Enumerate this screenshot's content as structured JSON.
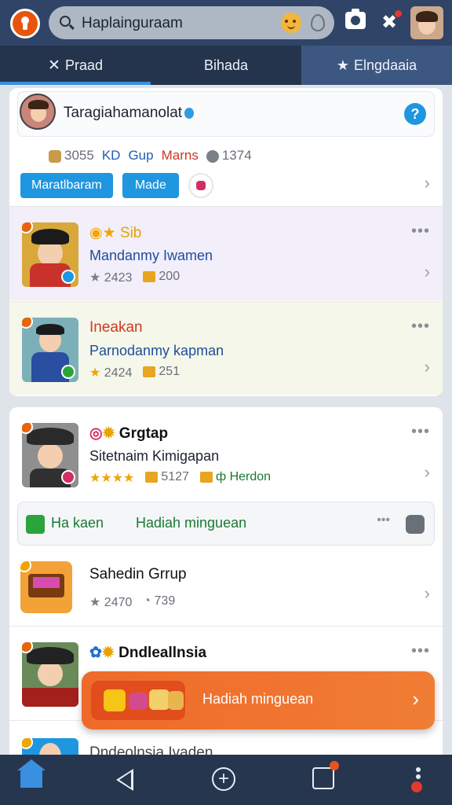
{
  "search": {
    "value": "Haplainguraam"
  },
  "tabs": [
    {
      "label": "Praad"
    },
    {
      "label": "Bihada"
    },
    {
      "label": "Elngdaaia"
    }
  ],
  "profile": {
    "name": "Taragiahamanolat",
    "stats": [
      "3055",
      "KD",
      "Gup",
      "Marns",
      "1374"
    ]
  },
  "buttons": {
    "primary": "Maratlbaram",
    "secondary": "Made"
  },
  "items": [
    {
      "title": "Sib",
      "subtitle": "Mandanmy Iwamen",
      "rating": "2423",
      "gifts": "200"
    },
    {
      "title": "Ineakan",
      "subtitle": "Parnodanmy kapman",
      "rating": "2424",
      "gifts": "251"
    },
    {
      "title": "Grgtap",
      "subtitle": "Sitetnaim Kimigapan",
      "rating": "5127",
      "extra": "Herdon"
    }
  ],
  "banner": {
    "left": "Ha kaen",
    "right": "Hadiah minguean"
  },
  "items2": [
    {
      "title": "Sahedin Grrup",
      "rating": "2470",
      "views": "739"
    },
    {
      "title": "Dndleallnsia"
    }
  ],
  "promo": {
    "label": "Hadiah minguean"
  },
  "partial": {
    "title": "Dndeolnsia Ivaden"
  }
}
